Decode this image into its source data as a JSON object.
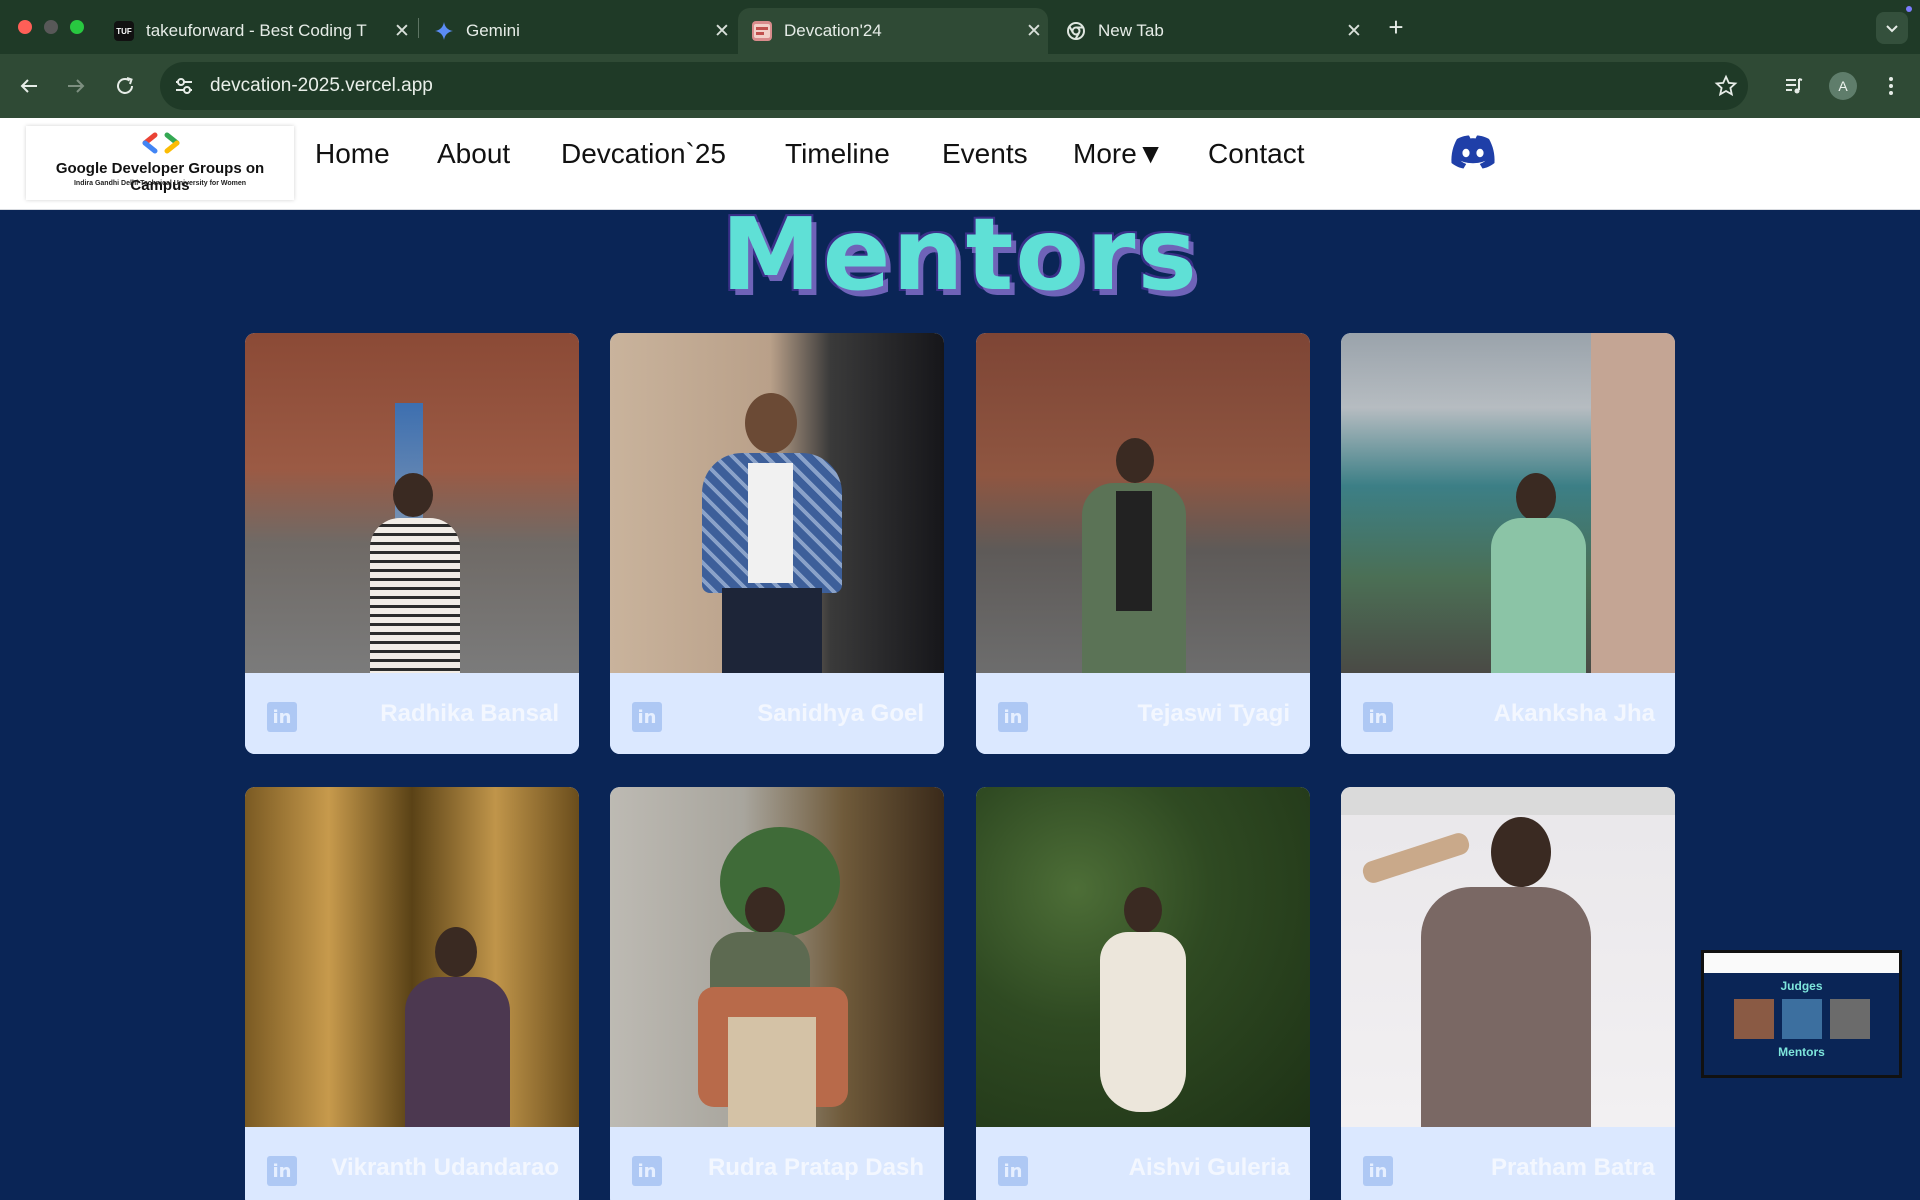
{
  "browser": {
    "tabs": [
      {
        "title": "takeuforward - Best Coding T",
        "active": false,
        "icon": "tuf-icon"
      },
      {
        "title": "Gemini",
        "active": false,
        "icon": "gemini-sparkle-icon"
      },
      {
        "title": "Devcation'24",
        "active": true,
        "icon": "devcation-favicon"
      },
      {
        "title": "New Tab",
        "active": false,
        "icon": "chrome-icon"
      }
    ],
    "url": "devcation-2025.vercel.app",
    "profile_initial": "A"
  },
  "header": {
    "logo_title": "Google Developer Groups on Campus",
    "logo_subtitle": "Indira Gandhi Delhi Technical University for Women",
    "nav": [
      "Home",
      "About",
      "Devcation`25",
      "Timeline",
      "Events",
      "More▼",
      "Contact"
    ]
  },
  "section": {
    "title": "Mentors"
  },
  "mentors": [
    {
      "name": "Radhika Bansal"
    },
    {
      "name": "Sanidhya Goel"
    },
    {
      "name": "Tejaswi Tyagi"
    },
    {
      "name": "Akanksha Jha"
    },
    {
      "name": "Vikranth Udandarao"
    },
    {
      "name": "Rudra Pratap Dash"
    },
    {
      "name": "Aishvi Guleria"
    },
    {
      "name": "Pratham Batra"
    }
  ],
  "linkedin_glyph": "in",
  "pip": {
    "heading_1": "Judges",
    "heading_2": "Mentors"
  },
  "colors": {
    "page_bg": "#0a2556",
    "card_caption_bg": "#dbe8ff",
    "title_fill": "#5fe0d6",
    "title_shadow": "#6f63b8",
    "tab_bar": "#1f3a27",
    "toolbar": "#2f4a35"
  }
}
